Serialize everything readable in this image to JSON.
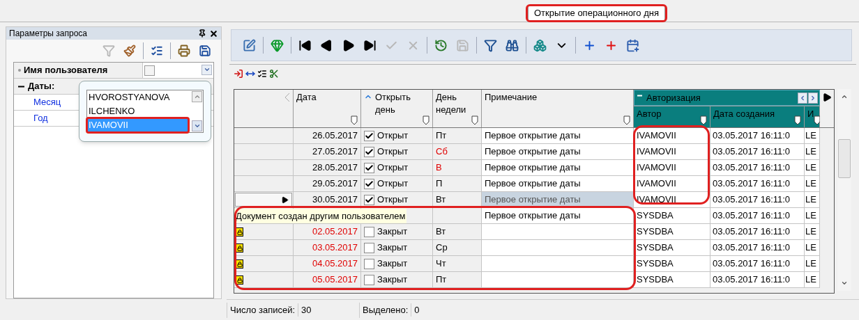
{
  "tab": {
    "label": "Открытие операционного дня",
    "selected": true
  },
  "query_panel": {
    "title": "Параметры запроса",
    "toolbar": [
      {
        "kind": "filter",
        "disabled": true
      },
      {
        "kind": "brush",
        "disabled": false
      },
      {
        "kind": "sep"
      },
      {
        "kind": "list",
        "disabled": false
      },
      {
        "kind": "sep"
      },
      {
        "kind": "print",
        "disabled": false
      },
      {
        "kind": "save",
        "disabled": false
      }
    ],
    "params": [
      {
        "label": "Имя пользователя",
        "kind": "field",
        "checked": false
      },
      {
        "label": "Даты:",
        "kind": "group",
        "expanded": true,
        "children": [
          {
            "label": "Месяц"
          },
          {
            "label": "Год"
          }
        ]
      }
    ],
    "dropdown": {
      "options": [
        {
          "label": "HVOROSTYANOVA",
          "selected": false
        },
        {
          "label": "ILCHENKO",
          "selected": false
        },
        {
          "label": "IVAMOVII",
          "selected": true
        }
      ]
    }
  },
  "toolbar": [
    {
      "kind": "edit",
      "disabled": false
    },
    {
      "kind": "sep"
    },
    {
      "kind": "gem",
      "disabled": false
    },
    {
      "kind": "sep"
    },
    {
      "kind": "first",
      "disabled": false
    },
    {
      "kind": "prev",
      "disabled": false
    },
    {
      "kind": "next",
      "disabled": false
    },
    {
      "kind": "last",
      "disabled": false
    },
    {
      "kind": "apply",
      "disabled": true
    },
    {
      "kind": "cancel",
      "disabled": true
    },
    {
      "kind": "sep"
    },
    {
      "kind": "refresh",
      "disabled": false
    },
    {
      "kind": "save",
      "disabled": true
    },
    {
      "kind": "sep"
    },
    {
      "kind": "filter",
      "disabled": false
    },
    {
      "kind": "find",
      "disabled": false
    },
    {
      "kind": "sep"
    },
    {
      "kind": "cubes",
      "disabled": false
    },
    {
      "kind": "caret",
      "disabled": false
    },
    {
      "kind": "sep"
    },
    {
      "kind": "plus",
      "disabled": false
    },
    {
      "kind": "add",
      "disabled": false
    },
    {
      "kind": "calendar",
      "disabled": false
    }
  ],
  "grid_toolbar": [
    {
      "kind": "enter"
    },
    {
      "kind": "fit"
    },
    {
      "kind": "checklist"
    },
    {
      "kind": "cut"
    }
  ],
  "table": {
    "columns": [
      {
        "label": "Дата",
        "sorted": false
      },
      {
        "label": "Открыть день",
        "sorted": true
      },
      {
        "label": "День недели",
        "sorted": false
      },
      {
        "label": "Примечание",
        "sorted": false
      }
    ],
    "band": {
      "label": "Авторизация",
      "expanded": true,
      "columns": [
        {
          "label": "Автор",
          "sorted": false
        },
        {
          "label": "Дата создания",
          "sorted": false
        },
        {
          "label": "И",
          "sorted": false
        }
      ]
    },
    "rows": [
      {
        "date": "26.05.2017",
        "open": true,
        "status": "Открыт",
        "day": "Пт",
        "weekend": false,
        "note": "Первое открытие даты",
        "author": "IVAMOVII",
        "created": "03.05.2017 16:11:0",
        "col_8": "LE",
        "locked": false,
        "selected": false
      },
      {
        "date": "27.05.2017",
        "open": true,
        "status": "Открыт",
        "day": "Сб",
        "weekend": true,
        "note": "Первое открытие даты",
        "author": "IVAMOVII",
        "created": "03.05.2017 16:11:0",
        "col_8": "LE",
        "locked": false,
        "selected": false
      },
      {
        "date": "28.05.2017",
        "open": true,
        "status": "Открыт",
        "day": "В",
        "weekend": true,
        "note": "Первое открытие даты",
        "author": "IVAMOVII",
        "created": "03.05.2017 16:11:0",
        "col_8": "LE",
        "locked": false,
        "selected": false
      },
      {
        "date": "29.05.2017",
        "open": true,
        "status": "Открыт",
        "day": "П",
        "weekend": false,
        "note": "Первое открытие даты",
        "author": "IVAMOVII",
        "created": "03.05.2017 16:11:0",
        "col_8": "LE",
        "locked": false,
        "selected": false
      },
      {
        "date": "30.05.2017",
        "open": true,
        "status": "Открыт",
        "day": "Вт",
        "weekend": false,
        "note": "Первое открытие даты",
        "author": "IVAMOVII",
        "created": "03.05.2017 16:11:0",
        "col_8": "LE",
        "locked": false,
        "selected": true
      },
      {
        "note": "Первое открытие даты",
        "author": "SYSDBA",
        "created": "03.05.2017 16:11:0",
        "col_8": "LE",
        "selected": false
      },
      {
        "date": "02.05.2017",
        "open": false,
        "status": "Закрыт",
        "day": "Вт",
        "weekend": false,
        "author": "SYSDBA",
        "created": "03.05.2017 16:11:0",
        "col_8": "LE",
        "locked": true,
        "selected": false
      },
      {
        "date": "03.05.2017",
        "open": false,
        "status": "Закрыт",
        "day": "Ср",
        "weekend": false,
        "author": "SYSDBA",
        "created": "03.05.2017 16:11:0",
        "col_8": "LE",
        "locked": true,
        "selected": false
      },
      {
        "date": "04.05.2017",
        "open": false,
        "status": "Закрыт",
        "day": "Чт",
        "weekend": false,
        "author": "SYSDBA",
        "created": "03.05.2017 16:11:0",
        "col_8": "LE",
        "locked": true,
        "selected": false
      },
      {
        "date": "05.05.2017",
        "open": false,
        "status": "Закрыт",
        "day": "Пт",
        "weekend": false,
        "author": "SYSDBA",
        "created": "03.05.2017 16:11:0",
        "col_8": "LE",
        "locked": true,
        "selected": false
      }
    ],
    "tooltip": "Документ создан другим пользователем"
  },
  "status_bar": [
    {
      "label": "Число записей:",
      "value": "30"
    },
    {
      "label": "Выделено:",
      "value": "0"
    }
  ]
}
